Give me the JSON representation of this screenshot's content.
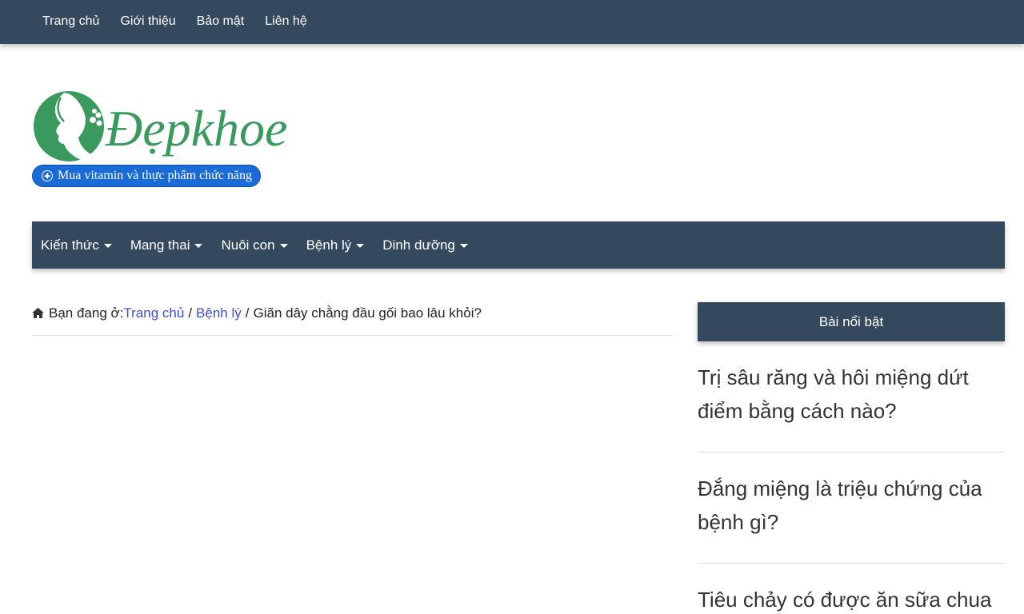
{
  "top_menu": {
    "items": [
      {
        "label": "Trang chủ"
      },
      {
        "label": "Giới thiệu"
      },
      {
        "label": "Bảo mật"
      },
      {
        "label": "Liên hệ"
      }
    ]
  },
  "logo": {
    "brand_text": "Đẹpkhoe",
    "shop_button_label": "Mua vitamin và thực phẩm chức năng",
    "brand_color": "#3a9a5e"
  },
  "main_menu": {
    "items": [
      {
        "label": "Kiến thức"
      },
      {
        "label": "Mang thai"
      },
      {
        "label": "Nuôi con"
      },
      {
        "label": "Bệnh lý"
      },
      {
        "label": "Dinh dưỡng"
      }
    ]
  },
  "breadcrumb": {
    "prefix": "Bạn đang ở:",
    "home": "Trang chủ",
    "separator": "/",
    "category": "Bệnh lý",
    "current": "Giãn dây chằng đầu gối bao lâu khỏi?"
  },
  "sidebar": {
    "title": "Bài nổi bật",
    "posts": [
      {
        "title": "Trị sâu răng và hôi miệng dứt điểm bằng cách nào?"
      },
      {
        "title": "Đắng miệng là triệu chứng của bệnh gì?"
      },
      {
        "title": "Tiêu chảy có được ăn sữa chua"
      }
    ]
  },
  "colors": {
    "nav_bg": "#34495e",
    "link": "#3c4fd6",
    "pill_bg": "#1a6bd6"
  }
}
